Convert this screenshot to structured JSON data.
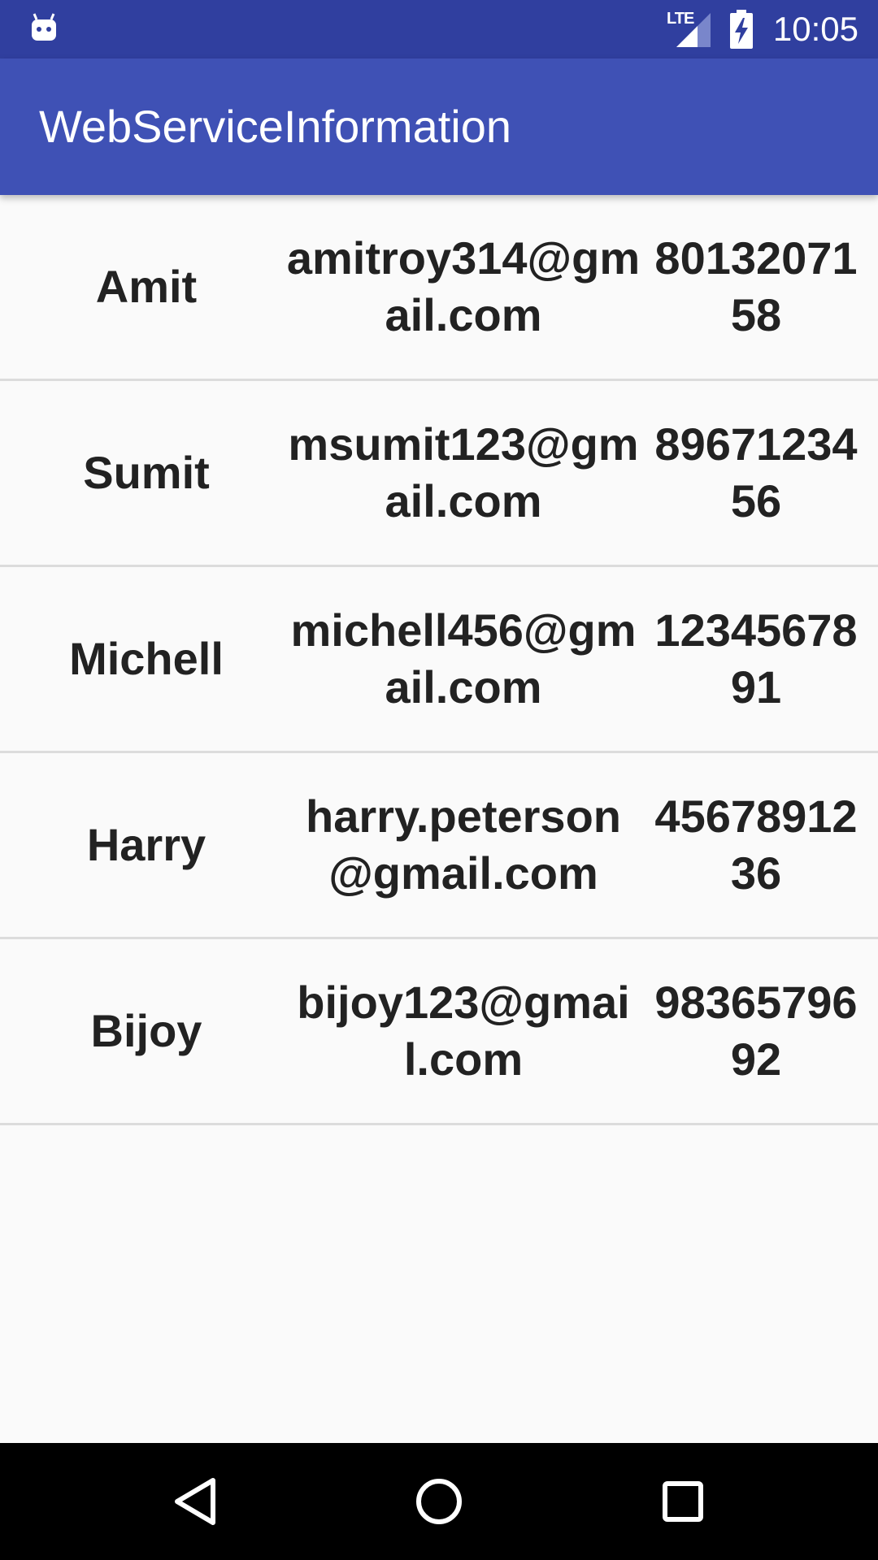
{
  "status_bar": {
    "network_label": "LTE",
    "time": "10:05",
    "icons": [
      "android-debug-icon",
      "lte-signal-icon",
      "battery-charging-icon"
    ]
  },
  "app_bar": {
    "title": "WebServiceInformation",
    "color": "#3f51b5"
  },
  "status_bar_color": "#303f9f",
  "contacts": [
    {
      "name": "Amit",
      "email": "amitroy314@gmail.com",
      "phone": "8013207158"
    },
    {
      "name": "Sumit",
      "email": "msumit123@gmail.com",
      "phone": "8967123456"
    },
    {
      "name": "Michell",
      "email": "michell456@gmail.com",
      "phone": "1234567891"
    },
    {
      "name": "Harry",
      "email": "harry.peterson@gmail.com",
      "phone": "4567891236"
    },
    {
      "name": "Bijoy",
      "email": "bijoy123@gmail.com",
      "phone": "9836579692"
    }
  ],
  "nav_bar": {
    "icons": [
      "back-icon",
      "home-icon",
      "recents-icon"
    ]
  }
}
